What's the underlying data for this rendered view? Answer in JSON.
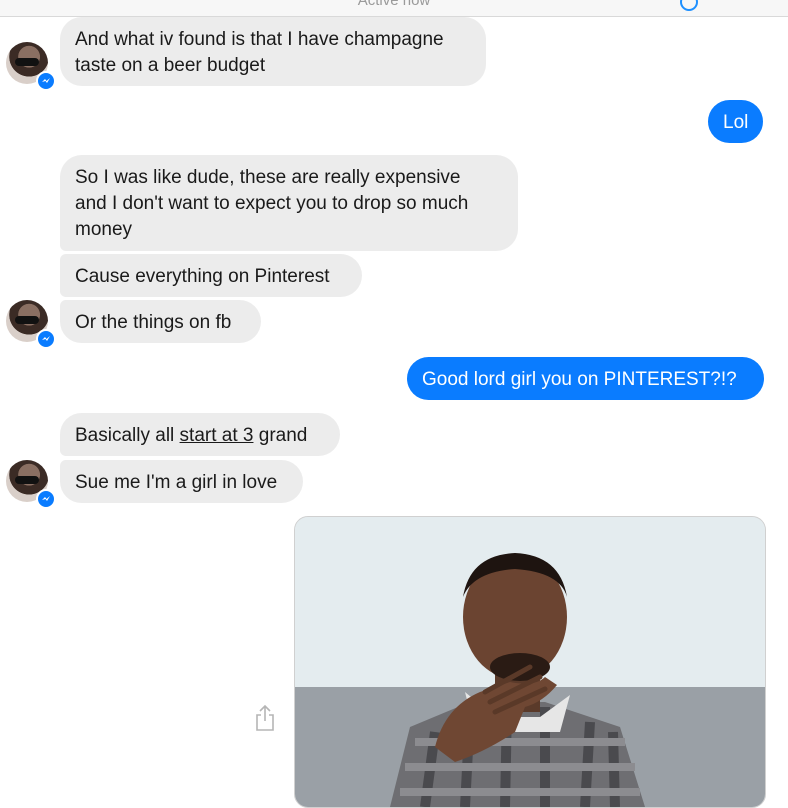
{
  "header": {
    "status_text": "Active now"
  },
  "messages": [
    {
      "from": "them",
      "lines": [
        "And what iv found is that I have champagne",
        "taste on a beer budget"
      ]
    },
    {
      "from": "me",
      "text": "Lol"
    },
    {
      "from": "them",
      "lines": [
        "So I was like dude, these are really expensive",
        "and I don't want to expect you to drop so much",
        "money"
      ]
    },
    {
      "from": "them",
      "text": "Cause everything on Pinterest"
    },
    {
      "from": "them",
      "text": "Or the things on fb"
    },
    {
      "from": "me",
      "text": "Good lord girl you on PINTEREST?!?"
    },
    {
      "from": "them",
      "parts": {
        "before": "Basically all ",
        "link": "start at 3",
        "after": " grand"
      }
    },
    {
      "from": "them",
      "text": "Sue me I'm a girl in love"
    }
  ],
  "colors": {
    "outgoing": "#0a7cff",
    "incoming": "#ececec"
  },
  "icons": {
    "share": "share-icon",
    "messenger": "messenger-badge-icon"
  }
}
